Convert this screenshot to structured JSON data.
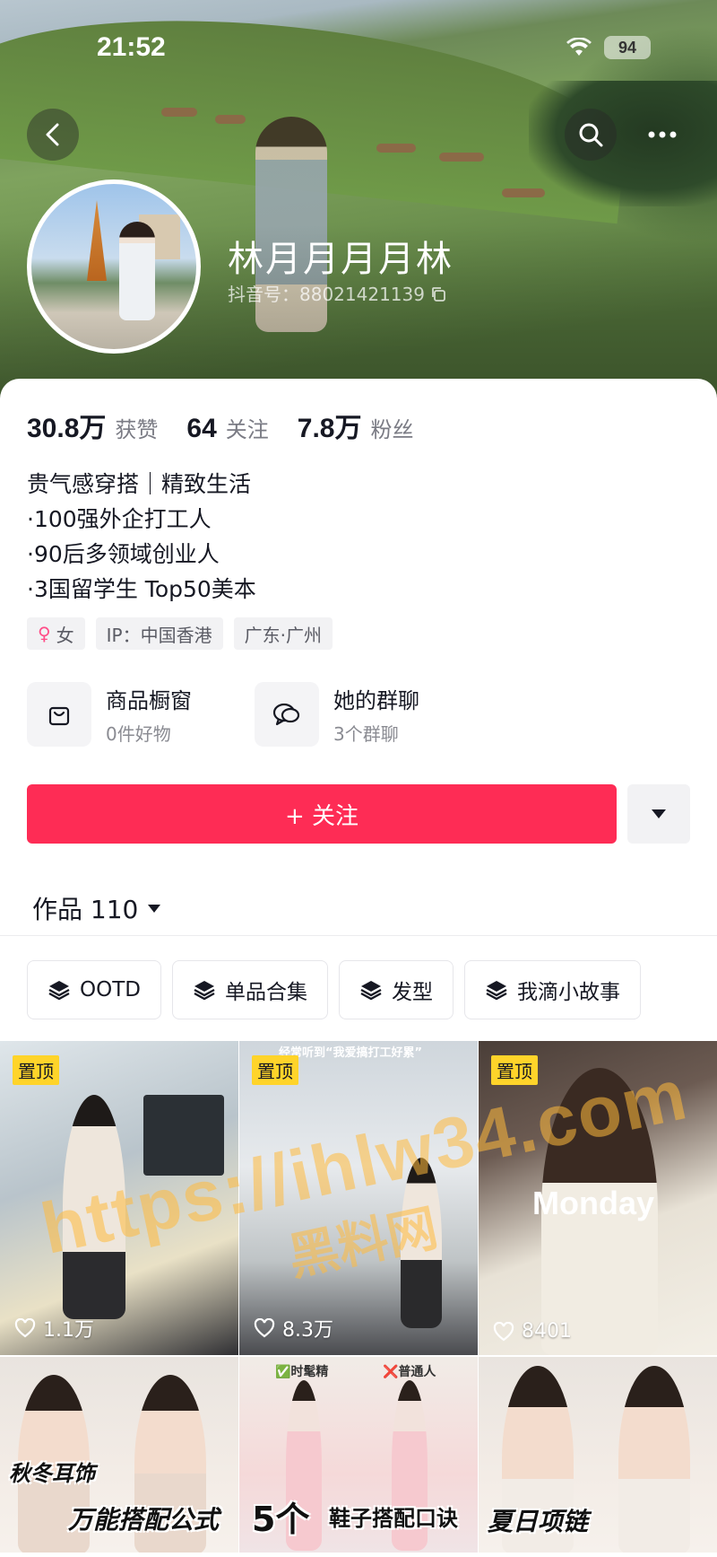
{
  "status_bar": {
    "time": "21:52",
    "battery": "94"
  },
  "profile": {
    "name": "林月月月月林",
    "douyin_id": "抖音号：88021421139"
  },
  "stats": [
    {
      "value": "30.8万",
      "label": "获赞"
    },
    {
      "value": "64",
      "label": "关注"
    },
    {
      "value": "7.8万",
      "label": "粉丝"
    }
  ],
  "bio": [
    "贵气感穿搭｜精致生活",
    "·100强外企打工人",
    "·90后多领域创业人",
    "·3国留学生 Top50美本"
  ],
  "tags": [
    {
      "icon": "female-icon",
      "text": "女"
    },
    {
      "text": "IP：中国香港"
    },
    {
      "text": "广东·广州"
    }
  ],
  "shortcuts": [
    {
      "icon": "shopping-bag-icon",
      "title": "商品橱窗",
      "subtitle": "0件好物"
    },
    {
      "icon": "chat-icon",
      "title": "她的群聊",
      "subtitle": "3个群聊"
    }
  ],
  "follow_button": {
    "label": "+ 关注"
  },
  "works_tab": {
    "label": "作品 110"
  },
  "collections": [
    {
      "icon": "layers-icon",
      "label": "OOTD"
    },
    {
      "icon": "layers-icon",
      "label": "单品合集"
    },
    {
      "icon": "layers-icon",
      "label": "发型"
    },
    {
      "icon": "layers-icon",
      "label": "我滴小故事"
    }
  ],
  "videos": [
    {
      "pinned": "置顶",
      "likes": "1.1万"
    },
    {
      "pinned": "置顶",
      "likes": "8.3万",
      "caption": "经常听到“我爱搞打工好累”"
    },
    {
      "pinned": "置顶",
      "likes": "8401",
      "caption": "Monday"
    },
    {
      "caption": "秋冬耳饰",
      "caption2": "万能搭配公式"
    },
    {
      "caption": "5个",
      "caption2": "鞋子搭配口诀",
      "label_a": "✅时髦精",
      "label_b": "❌普通人"
    },
    {
      "caption": "夏日项链"
    }
  ],
  "watermark": {
    "url": "https://ihlw34.com",
    "site": "黑料网"
  },
  "colors": {
    "accent": "#fe2c55",
    "pin": "#ffd42a"
  }
}
